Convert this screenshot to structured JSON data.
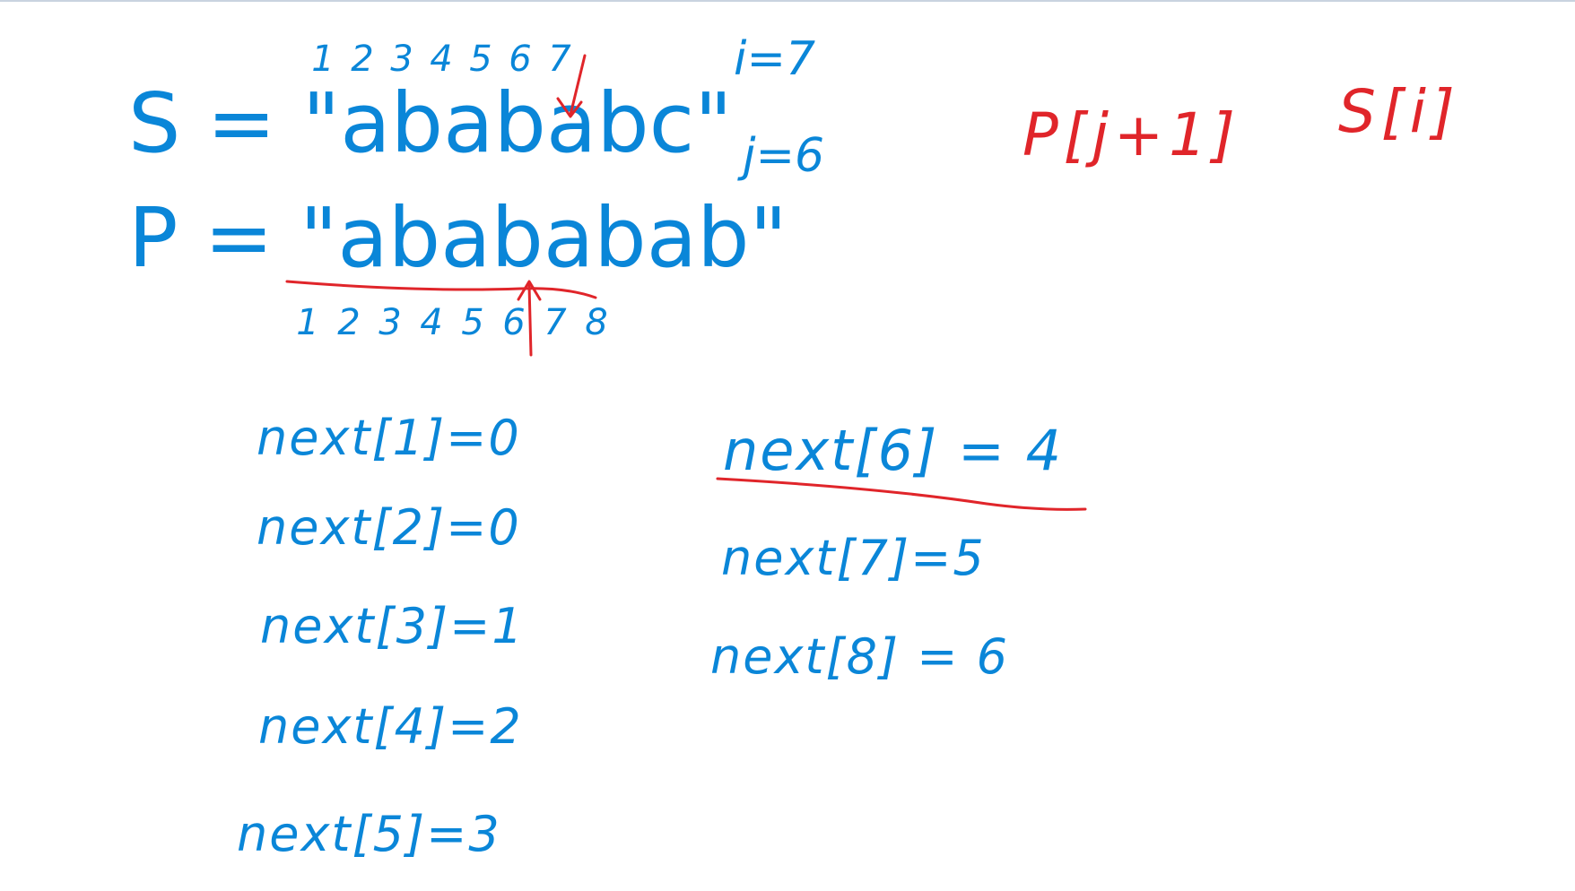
{
  "colors": {
    "blue": "#0a86d8",
    "red": "#e0252a"
  },
  "text_string": {
    "label": "S = ",
    "value": "\"abababc\""
  },
  "text_indices": [
    "1",
    "2",
    "3",
    "4",
    "5",
    "6",
    "7"
  ],
  "pattern_string": {
    "label": "P = ",
    "value": "\"abababab\""
  },
  "pattern_indices": [
    "1",
    "2",
    "3",
    "4",
    "5",
    "6",
    "7",
    "8"
  ],
  "pointers": {
    "i": "i=7",
    "j": "j=6"
  },
  "compare": {
    "pattern_char": "P[j+1]",
    "text_char": "S[i]"
  },
  "next_left": [
    "next[1]=0",
    "next[2]=0",
    "next[3]=1",
    "next[4]=2",
    "next[5]=3"
  ],
  "next_right": [
    "next[6] = 4",
    "next[7]=5",
    "next[8] = 6"
  ]
}
